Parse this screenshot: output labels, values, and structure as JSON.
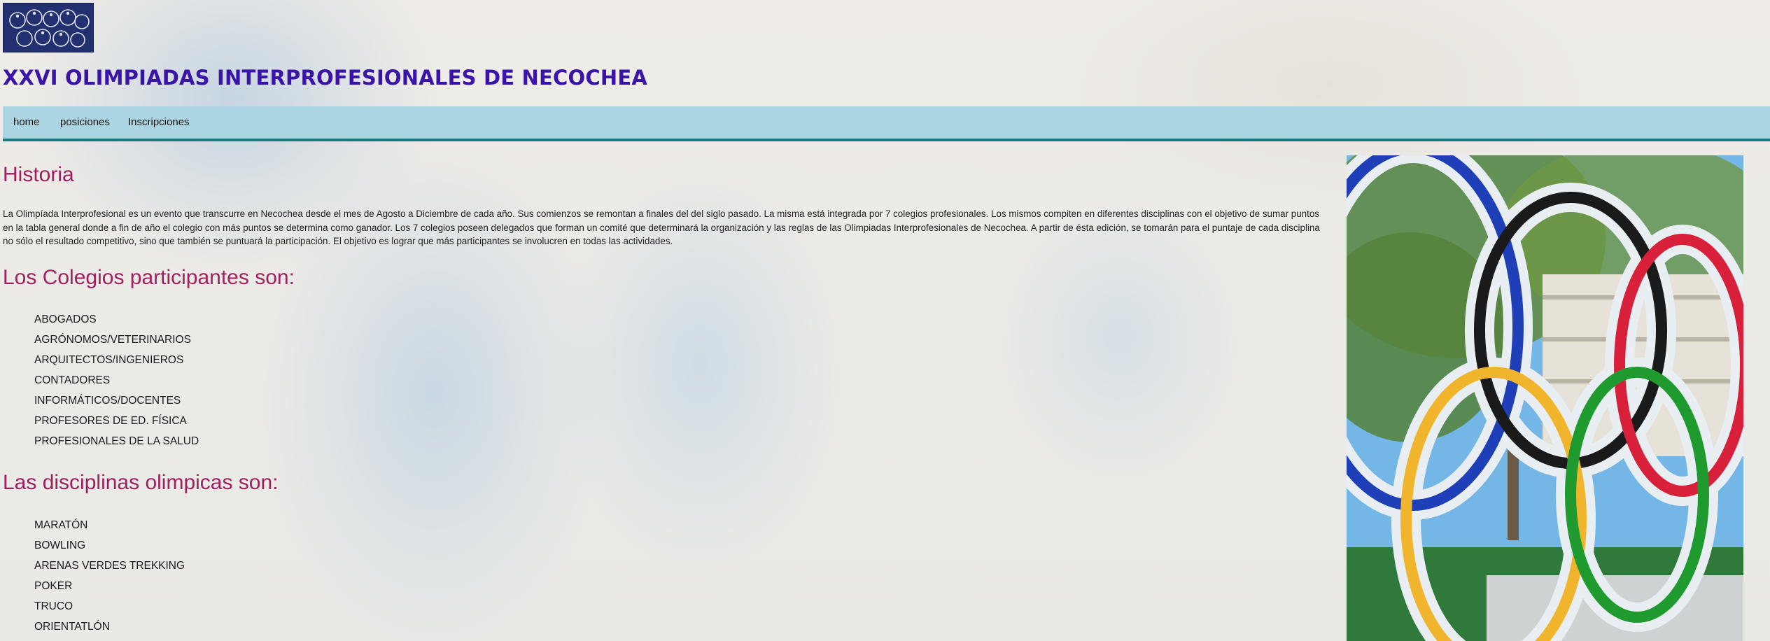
{
  "header": {
    "logo_name": "olympics-logo",
    "title": "XXVI OLIMPIADAS INTERPROFESIONALES DE NECOCHEA"
  },
  "nav": {
    "items": [
      "home",
      "posiciones",
      "Inscripciones"
    ]
  },
  "historia": {
    "heading": "Historia",
    "text": "La Olimpíada Interprofesional es un evento que transcurre en Necochea desde el mes de Agosto a Diciembre de cada año. Sus comienzos se remontan a finales del del siglo pasado. La misma está integrada por 7 colegios profesionales. Los mismos compiten en diferentes disciplinas con el objetivo de sumar puntos en la tabla general donde a fin de año el colegio con más puntos se determina como ganador. Los 7 colegios poseen delegados que forman un comité que determinará la organización y las reglas de las Olimpiadas Interprofesionales de Necochea. A partir de ésta edición, se tomarán para el puntaje de cada disciplina no sólo el resultado competitivo, sino que también se puntuará la participación. El objetivo es lograr que más participantes se involucren en todas las actividades."
  },
  "colegios": {
    "heading": "Los Colegios participantes son:",
    "items": [
      "ABOGADOS",
      "AGRÓNOMOS/VETERINARIOS",
      "ARQUITECTOS/INGENIEROS",
      "CONTADORES",
      "INFORMÁTICOS/DOCENTES",
      "PROFESORES DE ED. FÍSICA",
      "PROFESIONALES DE LA SALUD"
    ]
  },
  "disciplinas": {
    "heading": "Las disciplinas olimpicas son:",
    "items": [
      "MARATÓN",
      "BOWLING",
      "ARENAS VERDES TREKKING",
      "POKER",
      "TRUCO",
      "ORIENTATLÓN"
    ]
  },
  "photo": {
    "name": "olympic-rings-sculpture-photo",
    "ring_colors": [
      "#1f3fb8",
      "#1a1a1a",
      "#d8203a",
      "#f0b52c",
      "#1f9a2f"
    ]
  }
}
